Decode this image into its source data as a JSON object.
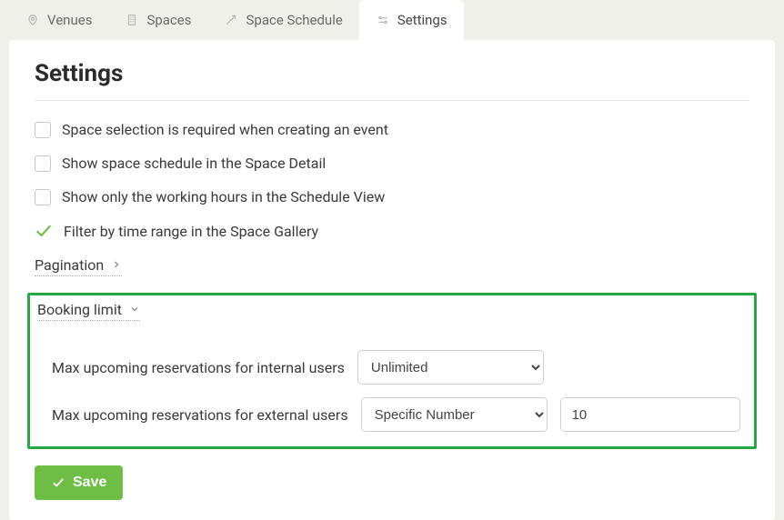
{
  "tabs": {
    "venues": "Venues",
    "spaces": "Spaces",
    "schedule": "Space Schedule",
    "settings": "Settings"
  },
  "page_title": "Settings",
  "options": {
    "space_selection_required": "Space selection is required when creating an event",
    "show_space_schedule_detail": "Show space schedule in the Space Detail",
    "show_working_hours_only": "Show only the working hours in the Schedule View",
    "filter_time_range_gallery": "Filter by time range in the Space Gallery"
  },
  "sections": {
    "pagination": "Pagination",
    "booking_limit": "Booking limit"
  },
  "booking": {
    "internal_label": "Max upcoming reservations for internal users",
    "external_label": "Max upcoming reservations for external users",
    "internal_value": "Unlimited",
    "external_value": "Specific Number",
    "external_number": "10",
    "select_options": [
      "Unlimited",
      "Specific Number"
    ]
  },
  "save_label": "Save"
}
